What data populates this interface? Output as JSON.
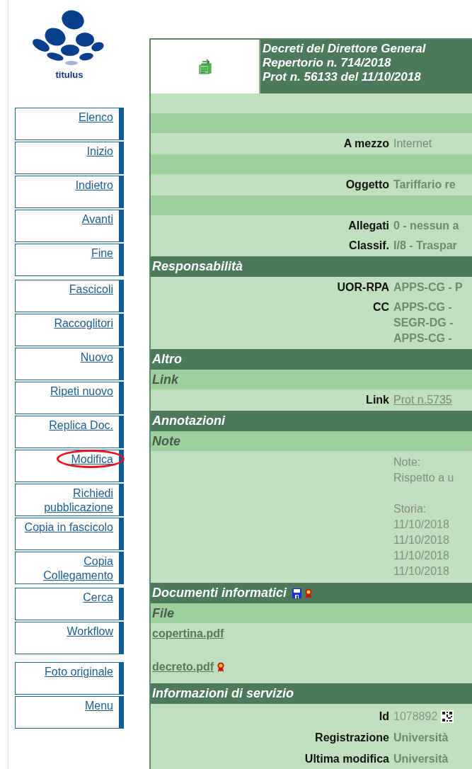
{
  "logo": {
    "text": "titulus"
  },
  "menu_groups": [
    [
      {
        "label": "Elenco",
        "highlighted": false
      },
      {
        "label": "Inizio",
        "highlighted": false
      },
      {
        "label": "Indietro",
        "highlighted": false
      },
      {
        "label": "Avanti",
        "highlighted": false
      },
      {
        "label": "Fine",
        "highlighted": false
      }
    ],
    [
      {
        "label": "Fascicoli",
        "highlighted": false
      },
      {
        "label": "Raccoglitori",
        "highlighted": false
      },
      {
        "label": "Nuovo",
        "highlighted": false
      },
      {
        "label": "Ripeti nuovo",
        "highlighted": false
      },
      {
        "label": "Replica Doc.",
        "highlighted": false
      },
      {
        "label": "Modifica",
        "highlighted": true
      },
      {
        "label": "Richiedi pubblicazione",
        "highlighted": false
      },
      {
        "label": "Copia in fascicolo",
        "highlighted": false
      },
      {
        "label": "Copia Collegamento",
        "highlighted": false
      }
    ],
    [
      {
        "label": "Cerca",
        "highlighted": false
      },
      {
        "label": "Workflow",
        "highlighted": false
      }
    ],
    [
      {
        "label": "Foto originale",
        "highlighted": false
      },
      {
        "label": "Menu",
        "highlighted": false
      }
    ]
  ],
  "record": {
    "title_lines": [
      "Decreti del Direttore General",
      "Repertorio n. 714/2018",
      "Prot n. 56133 del 11/10/2018"
    ],
    "rows": [
      {
        "kind": "blank"
      },
      {
        "kind": "band"
      },
      {
        "kind": "fields",
        "items": [
          {
            "label": "A mezzo",
            "values": [
              "Internet"
            ],
            "link": false
          }
        ]
      },
      {
        "kind": "band"
      },
      {
        "kind": "fields",
        "items": [
          {
            "label": "Oggetto",
            "values": [
              "Tariffario re"
            ],
            "link": false
          }
        ]
      },
      {
        "kind": "band"
      },
      {
        "kind": "fields",
        "items": [
          {
            "label": "Allegati",
            "values": [
              "0 - nessun a"
            ],
            "link": false
          },
          {
            "label": "Classif.",
            "values": [
              "I/8 - Traspar"
            ],
            "link": false
          }
        ]
      },
      {
        "kind": "section",
        "title": "Responsabilità",
        "tools": false
      },
      {
        "kind": "fields",
        "items": [
          {
            "label": "UOR-RPA",
            "values": [
              "APPS-CG - P"
            ],
            "link": false
          },
          {
            "label": "CC",
            "values": [
              "APPS-CG -",
              "SEGR-DG -",
              "APPS-CG -"
            ],
            "link": false
          }
        ]
      },
      {
        "kind": "section",
        "title": "Altro",
        "tools": false
      },
      {
        "kind": "subsection",
        "title": "Link"
      },
      {
        "kind": "fields",
        "items": [
          {
            "label": "Link",
            "values": [
              "Prot n.5735"
            ],
            "link": true
          }
        ]
      },
      {
        "kind": "section",
        "title": "Annotazioni",
        "tools": false
      },
      {
        "kind": "subsection",
        "title": "Note"
      },
      {
        "kind": "notes",
        "paragraphs": [
          [
            "Note:",
            "Rispetto a u"
          ],
          [
            "Storia:",
            "11/10/2018",
            "11/10/2018",
            "11/10/2018",
            "11/10/2018"
          ]
        ]
      },
      {
        "kind": "section",
        "title": "Documenti informatici",
        "tools": true
      },
      {
        "kind": "subsection",
        "title": "File"
      },
      {
        "kind": "files",
        "files": [
          {
            "name": "copertina.pdf",
            "signed": false
          },
          {
            "name": "decreto.pdf",
            "signed": true
          }
        ]
      },
      {
        "kind": "section",
        "title": "Informazioni di servizio",
        "tools": false
      },
      {
        "kind": "service",
        "items": [
          {
            "label": "Id",
            "value": "1078892",
            "qr": true
          },
          {
            "label": "Registrazione",
            "value": "Università",
            "qr": false
          },
          {
            "label": "Ultima modifica",
            "value": "Università",
            "qr": false
          }
        ]
      }
    ]
  }
}
